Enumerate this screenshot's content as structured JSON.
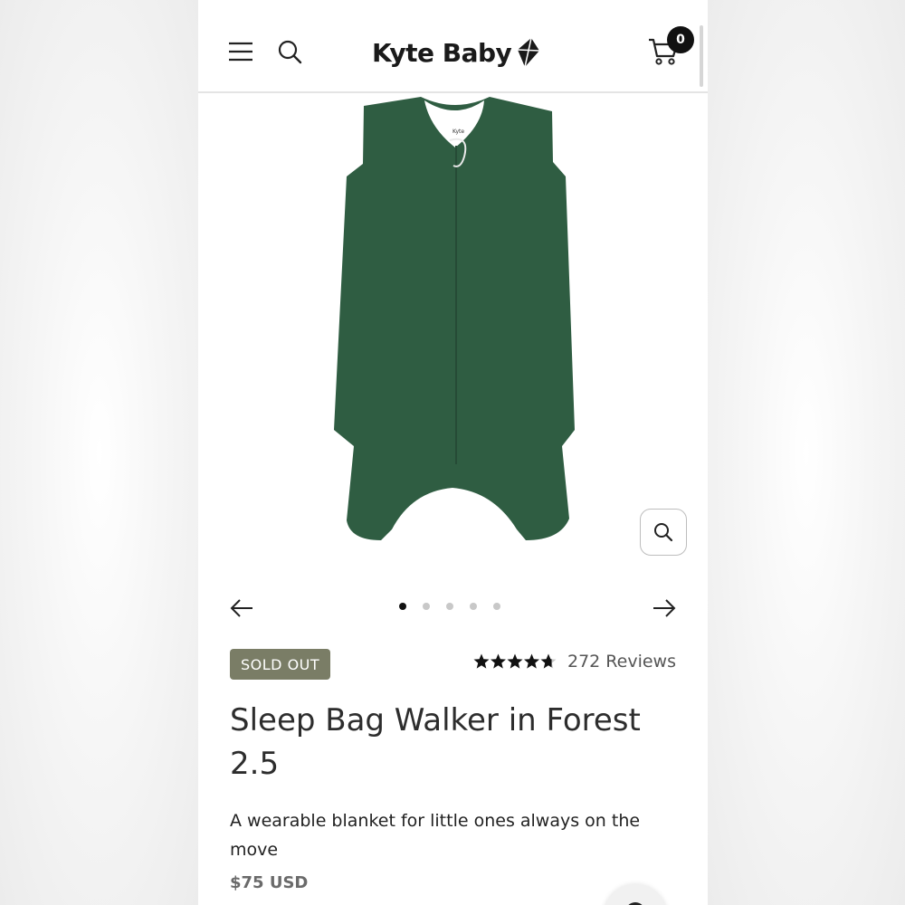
{
  "header": {
    "brand": "Kyte Baby",
    "cart_count": "0",
    "icons": {
      "menu": "hamburger-menu-icon",
      "search": "search-icon",
      "logo": "kite-icon",
      "cart": "cart-icon"
    }
  },
  "gallery": {
    "image_alt": "Sleep Bag Walker in Forest 2.5",
    "garment_color": "#2f5d42",
    "tag_text": "Kyte",
    "slide_count": 5,
    "active_slide": 1
  },
  "product": {
    "badge": "SOLD OUT",
    "rating": 4.7,
    "reviews": "272 Reviews",
    "title": "Sleep Bag Walker in Forest 2.5",
    "description": "A wearable blanket for little ones always on the move",
    "price": "$75 USD"
  },
  "colors": {
    "badge_bg": "#7a7d66",
    "accent": "#111111"
  }
}
